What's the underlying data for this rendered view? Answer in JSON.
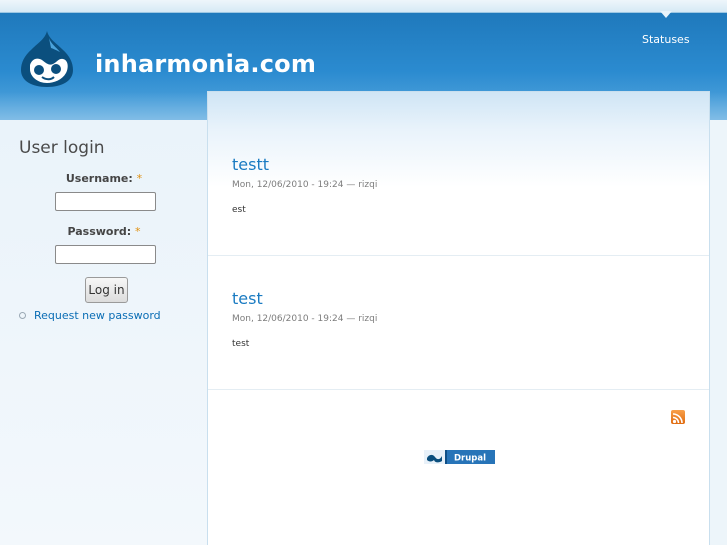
{
  "site": {
    "name": "inharmonia.com"
  },
  "nav": {
    "tabs": [
      {
        "label": "Statuses"
      }
    ]
  },
  "sidebar": {
    "login": {
      "title": "User login",
      "username_label": "Username:",
      "username_value": "",
      "password_label": "Password:",
      "password_value": "",
      "required_marker": "*",
      "submit_label": "Log in",
      "request_password": "Request new password"
    }
  },
  "posts": [
    {
      "title": "testt",
      "meta": "Mon, 12/06/2010 - 19:24 — rizqi",
      "body": "est"
    },
    {
      "title": "test",
      "meta": "Mon, 12/06/2010 - 19:24 — rizqi",
      "body": "test"
    }
  ],
  "footer": {
    "feed_icon": "rss-icon",
    "powered_by": "Drupal"
  },
  "colors": {
    "header_blue": "#2b8bd0",
    "link_blue": "#1a7bc2",
    "sidebar_bg": "#edf5fa",
    "rss_orange": "#f08a24",
    "required_orange": "#e09010"
  }
}
